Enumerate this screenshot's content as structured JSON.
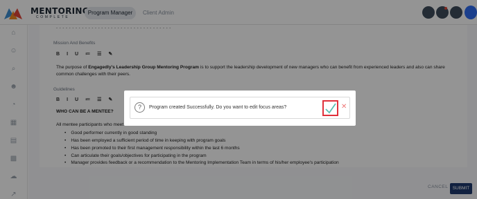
{
  "header": {
    "brand_line1": "MENTORING",
    "brand_line2": "COMPLETE",
    "tabs": [
      "Program Manager",
      "Client Admin"
    ]
  },
  "sidebar": {
    "icons": [
      "home-icon",
      "users-icon",
      "search-icon",
      "user-check-icon",
      "chart-icon",
      "calendar-icon",
      "documents-icon",
      "grid-icon",
      "cloud-upload-icon",
      "trend-icon"
    ]
  },
  "form": {
    "dashed_line": "- - - - - - - - - - - - - - - - - - - - - - - - - - - - - - - - - - - -",
    "mission_label": "Mission And Benefits",
    "mission_prefix": "The purpose of ",
    "mission_bold": "Engagedly's Leadership Group Mentoring Program",
    "mission_suffix": " is to support the leadership development of new managers who can benefit from experienced leaders and also can share",
    "mission_line2": "common challenges with their peers.",
    "guidelines_label": "Guidelines",
    "guidelines_heading": "WHO CAN BE A MENTEE?",
    "guidelines_intro_visible": "All mentee participants who meet th",
    "bullets": [
      "Good performer currently in good standing",
      "Has been employed a sufficient period of time in keeping with program goals",
      "Has been promoted to their first management responsibility within the last 6 months",
      "Can articulate their goals/objectives for participating in the program",
      "Manager provides feedback or a recommendation to the Mentoring Implementation Team in terms of his/her employee's participation"
    ],
    "toolbar": [
      "B",
      "I",
      "U",
      "≔",
      "☰",
      "✎"
    ]
  },
  "footer": {
    "cancel_label": "CANCEL",
    "submit_label": "SUBMIT"
  },
  "dialog": {
    "message": "Program created Successfully. Do you want to edit focus areas?",
    "question_glyph": "?",
    "close_glyph": "✕"
  },
  "colors": {
    "accent": "#1e3a6e",
    "highlight": "#e0303a",
    "check": "#5bc0b3"
  }
}
